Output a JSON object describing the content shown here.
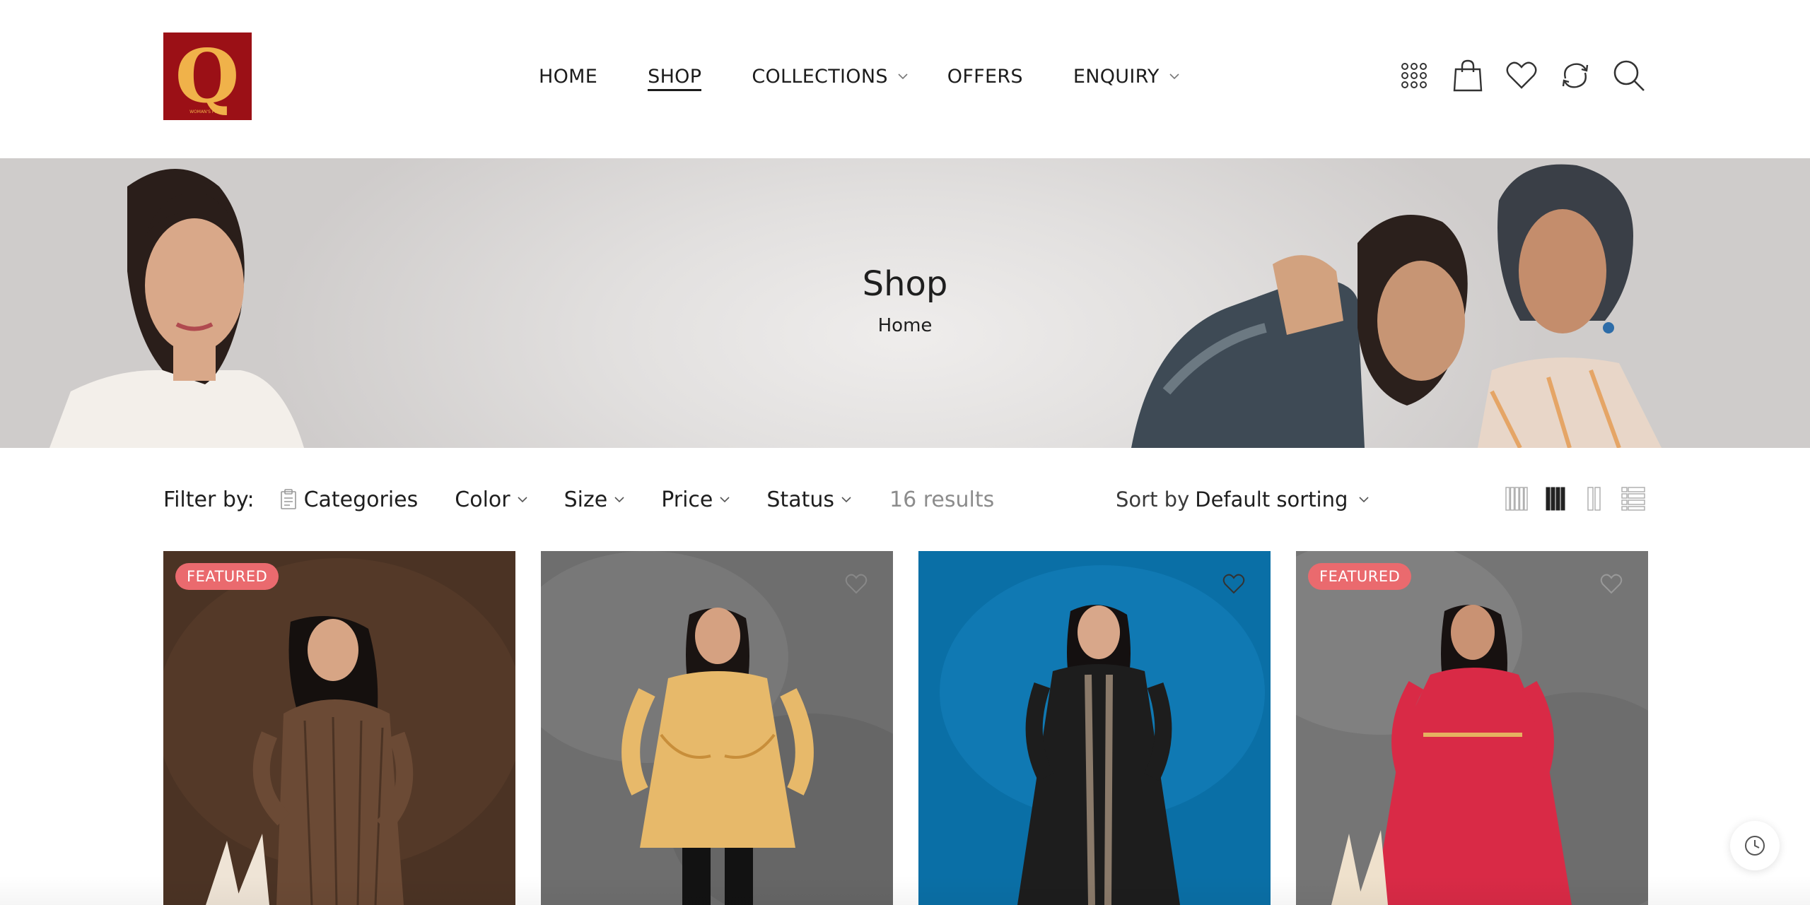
{
  "brand": {
    "logo_letter": "Q",
    "logo_tagline": "WOMAN'S PRIDE",
    "logo_bg_color": "#9b1016",
    "logo_fg_color": "#f0b24a"
  },
  "nav": {
    "items": [
      {
        "label": "HOME",
        "active": false,
        "has_submenu": false
      },
      {
        "label": "SHOP",
        "active": true,
        "has_submenu": false
      },
      {
        "label": "COLLECTIONS",
        "active": false,
        "has_submenu": true
      },
      {
        "label": "OFFERS",
        "active": false,
        "has_submenu": false
      },
      {
        "label": "ENQUIRY",
        "active": false,
        "has_submenu": true
      }
    ]
  },
  "header_icons": [
    "apps-grid-icon",
    "shopping-bag-icon",
    "heart-icon",
    "compare-refresh-icon",
    "search-icon"
  ],
  "hero": {
    "title": "Shop",
    "breadcrumb": "Home"
  },
  "filters": {
    "label": "Filter by:",
    "items": [
      {
        "label": "Categories",
        "icon": "clipboard-icon",
        "dropdown": false
      },
      {
        "label": "Color",
        "dropdown": true
      },
      {
        "label": "Size",
        "dropdown": true
      },
      {
        "label": "Price",
        "dropdown": true
      },
      {
        "label": "Status",
        "dropdown": true
      }
    ],
    "results": "16 results"
  },
  "sort": {
    "prefix": "Sort by",
    "value": "Default sorting"
  },
  "view_modes": [
    "grid-5-icon",
    "grid-4-icon",
    "grid-2-icon",
    "list-icon"
  ],
  "active_view": "grid-4-icon",
  "products": [
    {
      "badge": "FEATURED",
      "bg": "#4b3324",
      "outfit": "#6b4a35",
      "wishlist_visible": false
    },
    {
      "badge": "",
      "bg": "#6e6e6e",
      "outfit": "#e7b96a",
      "wishlist_visible": true
    },
    {
      "badge": "",
      "bg": "#0a6fa6",
      "outfit": "#1d1d1d",
      "wishlist_visible": true
    },
    {
      "badge": "FEATURED",
      "bg": "#757575",
      "outfit": "#d92a46",
      "wishlist_visible": true
    }
  ],
  "colors": {
    "badge": "#ea6a6e",
    "text": "#1e1e1e",
    "muted": "#8c8c8c"
  }
}
